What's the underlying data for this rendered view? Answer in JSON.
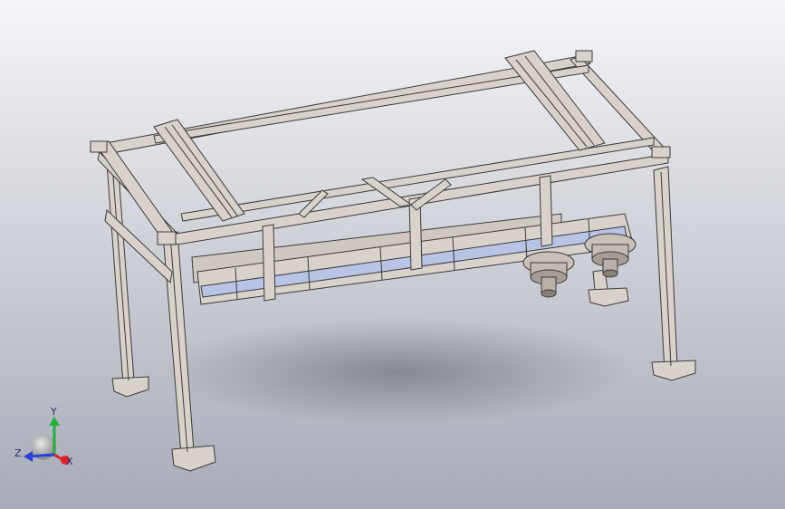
{
  "viewport": {
    "background_top": "#f4f5f8",
    "background_bottom": "#a7abb6",
    "model_color": "#d9d2cb",
    "edge_color": "#3a3a3a",
    "accent_color": "#b8c4e6"
  },
  "triad": {
    "x_label": "X",
    "y_label": "Y",
    "z_label": "Z",
    "x_color": "#e0202a",
    "y_color": "#1fb13a",
    "z_color": "#2a3fd6"
  }
}
